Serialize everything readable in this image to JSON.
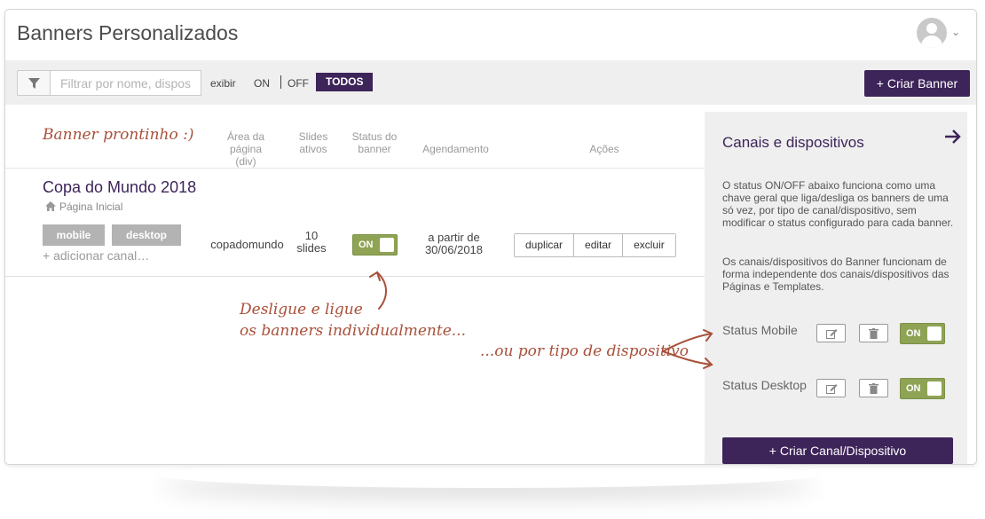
{
  "header": {
    "title": "Banners Personalizados",
    "avatar_icon": "user-avatar-icon",
    "menu_icon": "chevron-down-icon"
  },
  "toolbar": {
    "filter_icon": "filter-icon",
    "filter_placeholder": "Filtrar por nome, dispos",
    "exibir_label": "exibir",
    "on_label": "ON",
    "off_label": "OFF",
    "todos_label": "TODOS",
    "create_banner_label": "+  Criar Banner"
  },
  "table": {
    "annotation_title": "Banner prontinho :)",
    "columns": {
      "area_1": "Área da",
      "area_2": "página (div)",
      "slides_1": "Slides",
      "slides_2": "ativos",
      "status_1": "Status do",
      "status_2": "banner",
      "agendamento": "Agendamento",
      "acoes": "Ações"
    },
    "row": {
      "name": "Copa do Mundo 2018",
      "page_icon": "home-icon",
      "page": "Página Inicial",
      "channels": [
        "mobile",
        "desktop"
      ],
      "add_channel": "+ adicionar canal…",
      "area": "copadomundo",
      "slides_1": "10",
      "slides_2": "slides",
      "status": "ON",
      "schedule_1": "a partir de",
      "schedule_2": "30/06/2018",
      "actions": [
        "duplicar",
        "editar",
        "excluir"
      ]
    }
  },
  "sidebar": {
    "title": "Canais e dispositivos",
    "collapse_icon": "arrow-right-icon",
    "p1": "O status ON/OFF abaixo funciona como uma chave geral que liga/desliga os banners de uma só vez, por tipo de canal/dispositivo, sem modificar o status configurado para cada banner.",
    "p2": "Os canais/dispositivos do Banner funcionam de forma independente dos canais/dispositivos das Páginas e Templates.",
    "status_mobile": "Status Mobile",
    "status_desktop": "Status Desktop",
    "edit_icon": "edit-icon",
    "trash_icon": "trash-icon",
    "mobile_toggle": "ON",
    "desktop_toggle": "ON",
    "create_channel_label": "+  Criar Canal/Dispositivo"
  },
  "annotations": {
    "toggle_note_1": "Desligue e ligue",
    "toggle_note_2": "os banners individualmente...",
    "device_note": "...ou por tipo de dispositivo"
  },
  "colors": {
    "brand": "#3d2459",
    "toggle_on": "#8fa354",
    "annotation": "#a8503a",
    "panel_bg": "#efefef"
  }
}
